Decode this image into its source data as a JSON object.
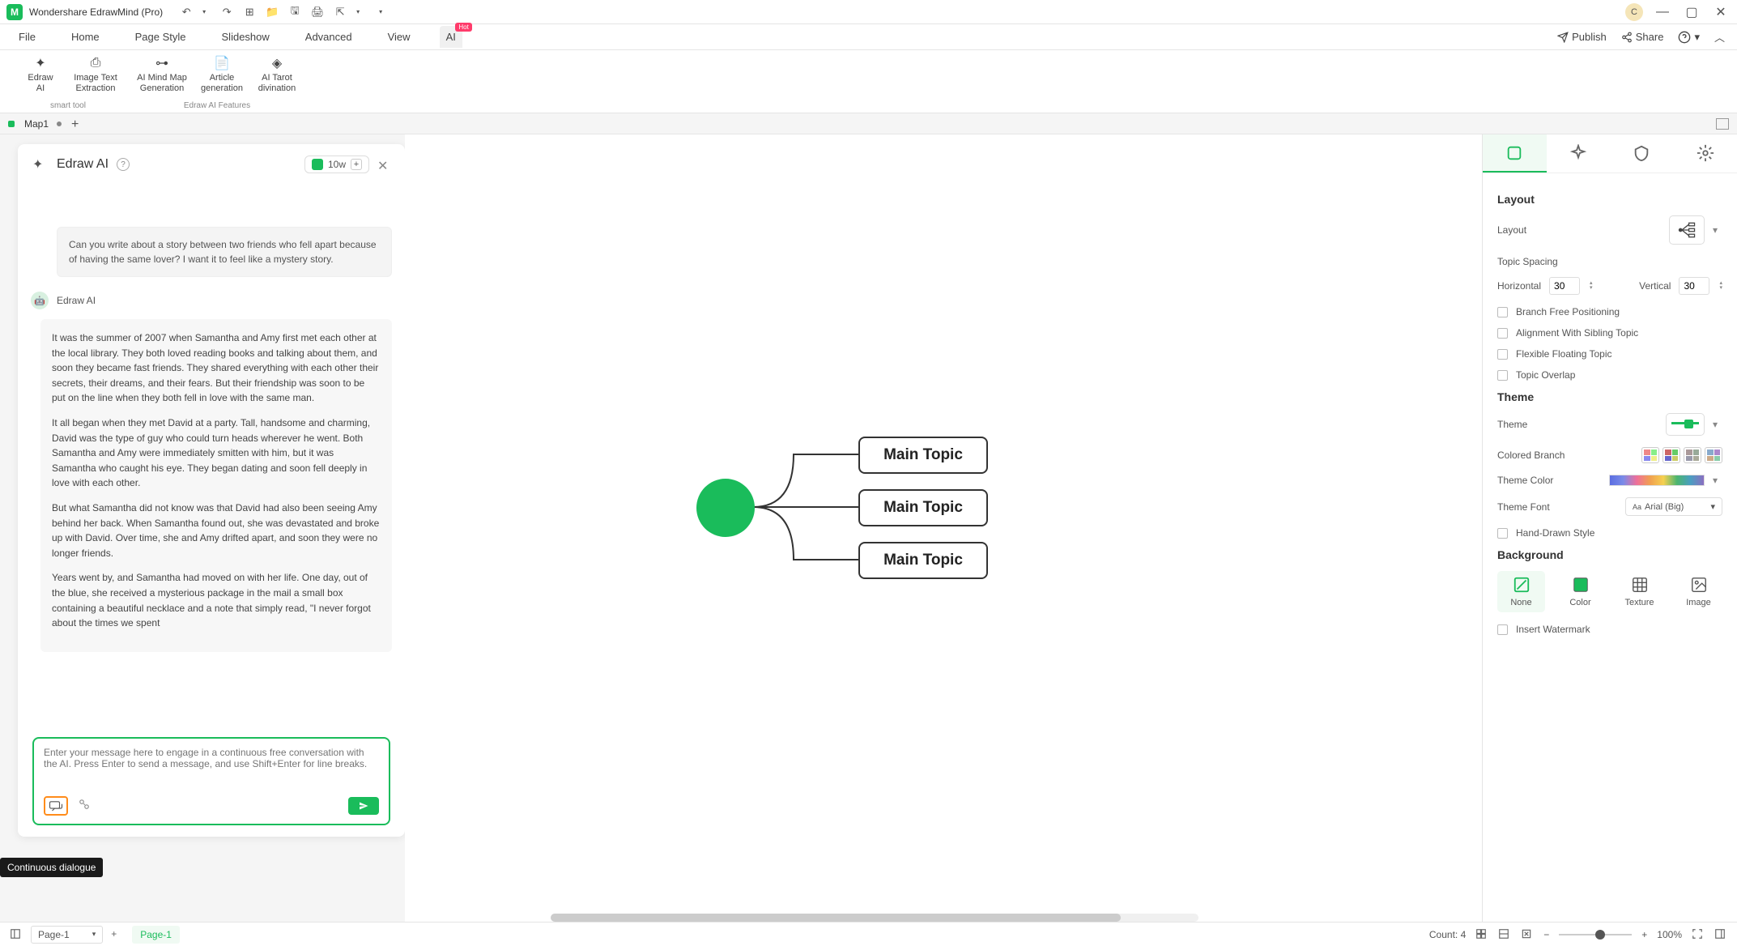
{
  "app": {
    "title": "Wondershare EdrawMind (Pro)"
  },
  "menubar": {
    "items": [
      "File",
      "Home",
      "Page Style",
      "Slideshow",
      "Advanced",
      "View"
    ],
    "ai_item": "AI",
    "hot_badge": "Hot",
    "publish": "Publish",
    "share": "Share"
  },
  "ribbon": {
    "group1_label": "smart tool",
    "group2_label": "Edraw AI Features",
    "items": [
      {
        "label": "Edraw\nAI"
      },
      {
        "label": "Image Text\nExtraction"
      },
      {
        "label": "AI Mind Map\nGeneration"
      },
      {
        "label": "Article\ngeneration"
      },
      {
        "label": "AI Tarot\ndivination"
      }
    ]
  },
  "tabs": {
    "doc": "Map1"
  },
  "ai_panel": {
    "title": "Edraw AI",
    "credits": "10w",
    "user_message": "Can you write about a story between two friends who fell apart because of having the same lover? I want it to feel like a mystery story.",
    "responder": "Edraw AI",
    "response_p1": "It was the summer of 2007 when Samantha and Amy first met each other at the local library. They both loved reading books and talking about them, and soon they became fast friends. They shared everything with each other  their secrets, their dreams, and their fears. But their friendship was soon to be put on the line when they both fell in love with the same man.",
    "response_p2": "It all began when they met David at a party. Tall, handsome and charming, David was the type of guy who could turn heads wherever he went. Both Samantha and Amy were immediately smitten with him, but it was Samantha who caught his eye. They began dating and soon fell deeply in love with each other.",
    "response_p3": "But what Samantha did not know was that David had also been seeing Amy behind her back. When Samantha found out, she was devastated and broke up with David. Over time, she and Amy drifted apart, and soon they were no longer friends.",
    "response_p4": "Years went by, and Samantha had moved on with her life. One day, out of the blue, she received a mysterious package in the mail  a small box containing a beautiful necklace and a note that simply read, \"I never forgot about the times we spent",
    "input_placeholder": "Enter your message here to engage in a continuous free conversation with the AI. Press Enter to send a message, and use Shift+Enter for line breaks.",
    "tooltip": "Continuous dialogue"
  },
  "mindmap": {
    "topics": [
      "Main Topic",
      "Main Topic",
      "Main Topic"
    ]
  },
  "right_panel": {
    "layout_title": "Layout",
    "layout_label": "Layout",
    "topic_spacing": "Topic Spacing",
    "horizontal_label": "Horizontal",
    "horizontal_val": "30",
    "vertical_label": "Vertical",
    "vertical_val": "30",
    "cb1": "Branch Free Positioning",
    "cb2": "Alignment With Sibling Topic",
    "cb3": "Flexible Floating Topic",
    "cb4": "Topic Overlap",
    "theme_title": "Theme",
    "theme_label": "Theme",
    "colored_branch": "Colored Branch",
    "theme_color": "Theme Color",
    "theme_font": "Theme Font",
    "font_value": "Arial (Big)",
    "hand_drawn": "Hand-Drawn Style",
    "background_title": "Background",
    "bg_none": "None",
    "bg_color": "Color",
    "bg_texture": "Texture",
    "bg_image": "Image",
    "watermark": "Insert Watermark"
  },
  "statusbar": {
    "page_select": "Page-1",
    "page_tab": "Page-1",
    "count": "Count: 4",
    "zoom": "100%"
  },
  "avatar": "C"
}
